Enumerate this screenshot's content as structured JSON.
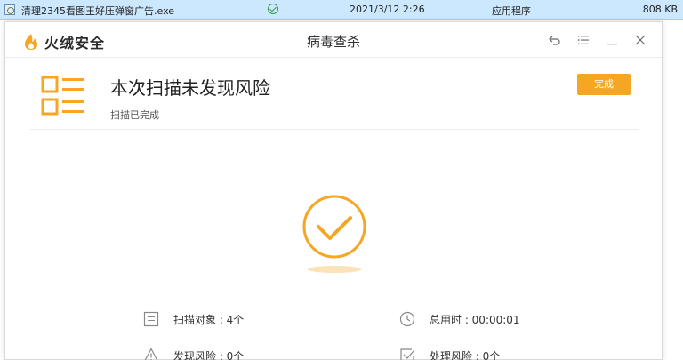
{
  "file_row": {
    "name": "清理2345看图王好压弹窗广告.exe",
    "date": "2021/3/12 2:26",
    "type": "应用程序",
    "size": "808 KB"
  },
  "window": {
    "brand": "火绒安全",
    "title": "病毒查杀",
    "controls": [
      "back-icon",
      "menu-icon",
      "minimize-icon",
      "close-icon"
    ]
  },
  "result": {
    "title": "本次扫描未发现风险",
    "subtitle": "扫描已完成",
    "done_label": "完成"
  },
  "stats": {
    "scan_objects": "扫描对象 : 4个",
    "total_time": "总用时 : 00:00:01",
    "risks_found": "发现风险 : 0个",
    "risks_handled": "处理风险 : 0个"
  },
  "colors": {
    "accent": "#f5a623",
    "selection": "#cce8ff",
    "text": "#333333"
  }
}
